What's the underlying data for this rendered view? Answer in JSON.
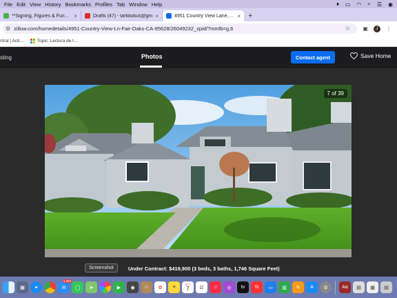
{
  "menubar": {
    "items": [
      "File",
      "Edit",
      "View",
      "History",
      "Bookmarks",
      "Profiles",
      "Tab",
      "Window",
      "Help"
    ]
  },
  "tabs": [
    {
      "title": "**Signing, Figures & Funds to",
      "color": "#4caf50"
    },
    {
      "title": "Drafts (47) - tarkitukus@gm",
      "color": "#d93025"
    },
    {
      "title": "4951 Country View Lane, Fair",
      "color": "#0a6df0",
      "active": true
    }
  ],
  "newtab_label": "+",
  "address": {
    "url": "zillow.com/homedetails/4951-Country-View-Ln-Fair-Oaks-CA-95628/26049232_zpid/?mmlb=g,6",
    "avatar": "J"
  },
  "bookmarks": [
    {
      "label": "ntral | Acti..."
    },
    {
      "label": "Topic: Lectura de l..."
    }
  ],
  "zillow": {
    "back_label": "sting",
    "photos_label": "Photos",
    "contact_button": "Contact agent",
    "save_label": "Save Home"
  },
  "gallery": {
    "counter": "7 of 39",
    "caption": "Under Contract: $419,900 (3 beds, 3 baths, 1,746 Square Feet)",
    "tooltip": "Screenshot"
  },
  "dock": {
    "mail_badge": "4,990",
    "calendar_month": "OCT",
    "calendar_day": "7"
  },
  "colors": {
    "menubar": "#c9c2e6",
    "tabstrip": "#d8d2f1",
    "zillow_header": "#1c1c1e",
    "contact_button": "#0a6df0",
    "dock": "#6e7bb0"
  }
}
